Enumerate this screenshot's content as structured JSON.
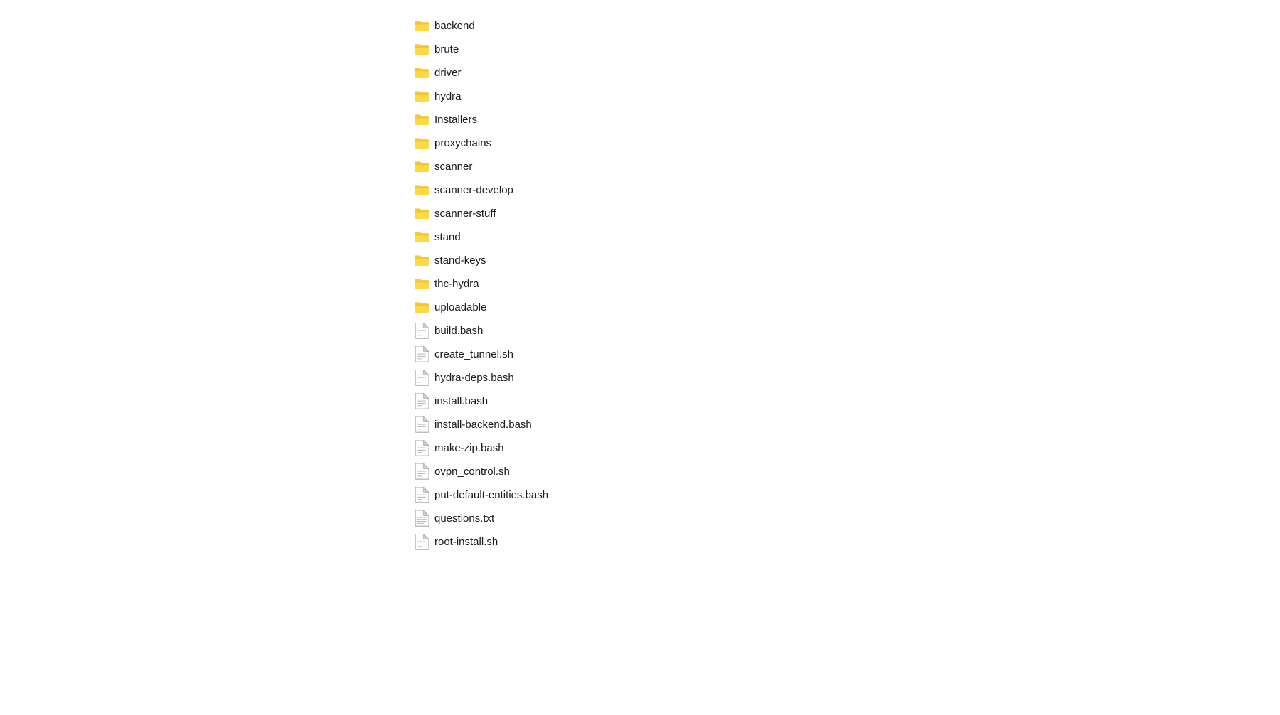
{
  "fileList": {
    "items": [
      {
        "name": "backend",
        "type": "folder"
      },
      {
        "name": "brute",
        "type": "folder"
      },
      {
        "name": "driver",
        "type": "folder"
      },
      {
        "name": "hydra",
        "type": "folder"
      },
      {
        "name": "Installers",
        "type": "folder"
      },
      {
        "name": "proxychains",
        "type": "folder"
      },
      {
        "name": "scanner",
        "type": "folder"
      },
      {
        "name": "scanner-develop",
        "type": "folder"
      },
      {
        "name": "scanner-stuff",
        "type": "folder"
      },
      {
        "name": "stand",
        "type": "folder"
      },
      {
        "name": "stand-keys",
        "type": "folder"
      },
      {
        "name": "thc-hydra",
        "type": "folder"
      },
      {
        "name": "uploadable",
        "type": "folder"
      },
      {
        "name": "build.bash",
        "type": "file"
      },
      {
        "name": "create_tunnel.sh",
        "type": "file"
      },
      {
        "name": "hydra-deps.bash",
        "type": "file"
      },
      {
        "name": "install.bash",
        "type": "file"
      },
      {
        "name": "install-backend.bash",
        "type": "file"
      },
      {
        "name": "make-zip.bash",
        "type": "file"
      },
      {
        "name": "ovpn_control.sh",
        "type": "file"
      },
      {
        "name": "put-default-entities.bash",
        "type": "file"
      },
      {
        "name": "questions.txt",
        "type": "file-text"
      },
      {
        "name": "root-install.sh",
        "type": "file"
      }
    ]
  },
  "colors": {
    "folderYellow": "#F5C842",
    "folderDark": "#E5A800",
    "fileGray": "#9E9E9E",
    "fileWhite": "#FFFFFF"
  }
}
